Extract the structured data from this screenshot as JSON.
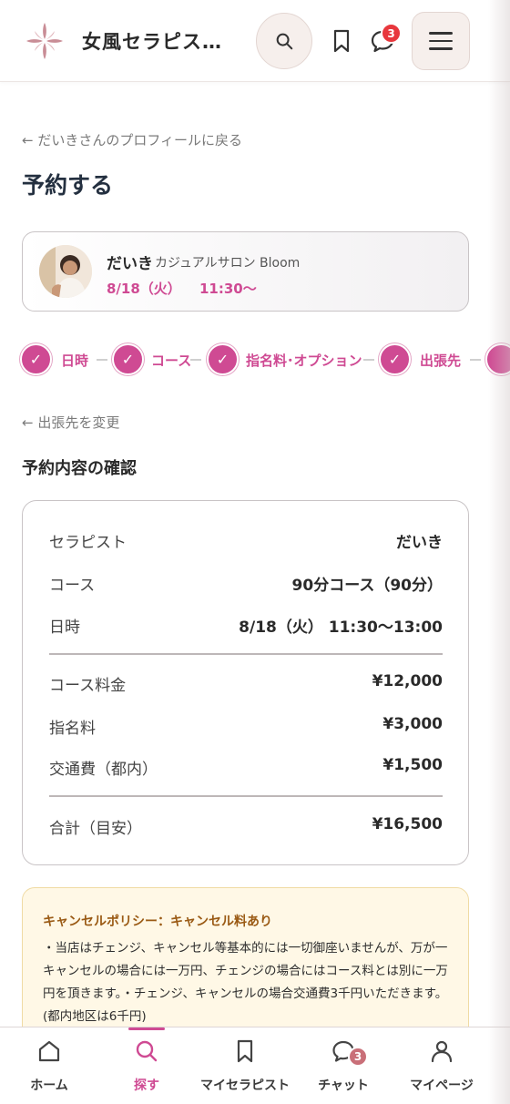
{
  "header": {
    "brand": "女風セラピス…",
    "chat_badge": "3"
  },
  "back_links": {
    "profile": "← だいきさんのプロフィールに戻る",
    "destination": "← 出張先を変更"
  },
  "page_title": "予約する",
  "therapist": {
    "name": "だいき",
    "salon": "カジュアルサロン Bloom",
    "date": "8/18（火）",
    "time": "11:30〜"
  },
  "steps": [
    {
      "label": "日時"
    },
    {
      "label": "コース"
    },
    {
      "label": "指名料･オプション"
    },
    {
      "label": "出張先"
    }
  ],
  "section_title": "予約内容の確認",
  "summary": {
    "therapist_label": "セラピスト",
    "therapist_value": "だいき",
    "course_label": "コース",
    "course_value": "90分コース（90分）",
    "datetime_label": "日時",
    "datetime_value": "8/18（火） 11:30〜13:00",
    "course_fee_label": "コース料金",
    "course_fee_value": "¥12,000",
    "nomination_label": "指名料",
    "nomination_value": "¥3,000",
    "transport_label": "交通費（都内）",
    "transport_value": "¥1,500",
    "total_label": "合計（目安）",
    "total_value": "¥16,500"
  },
  "policy": {
    "title": "キャンセルポリシー：キャンセル料あり",
    "body": "・当店はチェンジ、キャンセル等基本的には一切御座いませんが、万が一キャンセルの場合には一万円、チェンジの場合にはコース料とは別に一万円を頂きます。・チェンジ、キャンセルの場合交通費3千円いただきます。(都内地区は6千円)"
  },
  "bottom_nav": {
    "items": [
      {
        "label": "ホーム",
        "icon": "home-icon"
      },
      {
        "label": "探す",
        "icon": "search-icon"
      },
      {
        "label": "マイセラピスト",
        "icon": "bookmark-icon"
      },
      {
        "label": "チャット",
        "icon": "chat-icon"
      },
      {
        "label": "マイページ",
        "icon": "user-icon"
      }
    ],
    "chat_badge": "3",
    "active_index": 1
  },
  "colors": {
    "accent": "#cf4a93",
    "badge": "#e8373d",
    "policy_bg": "#fff8e6"
  }
}
